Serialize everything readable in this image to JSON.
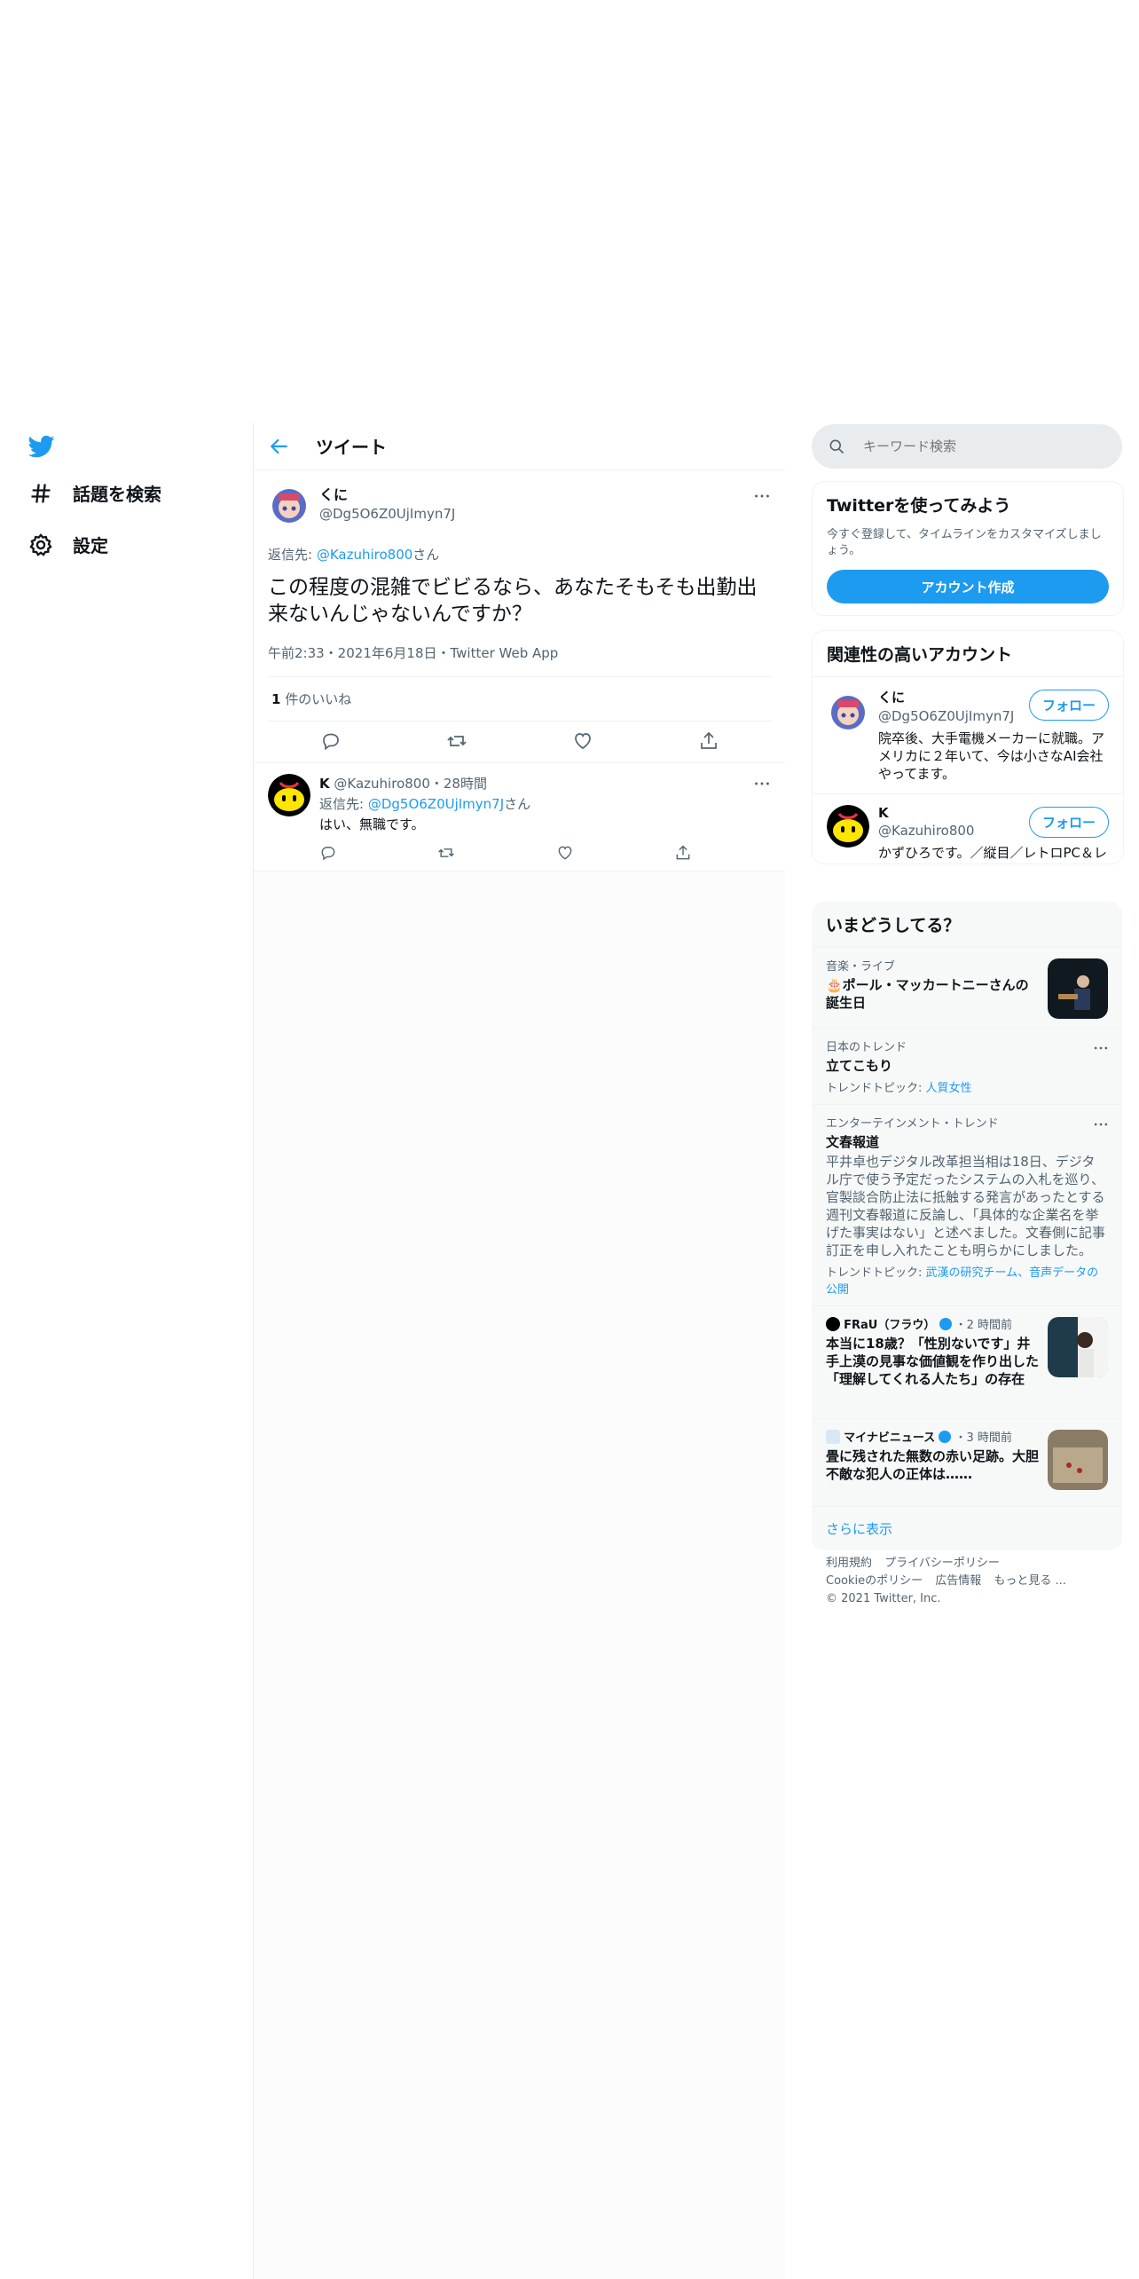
{
  "nav": {
    "explore_label": "話題を検索",
    "settings_label": "設定"
  },
  "main": {
    "header_title": "ツイート",
    "tweet": {
      "name": "くに",
      "handle": "@Dg5O6Z0UjImyn7J",
      "reply_prefix": "返信先: ",
      "reply_to": "@Kazuhiro800",
      "reply_suffix": "さん",
      "text": "この程度の混雑でビビるなら、あなたそもそも出勤出来ないんじゃないんですか？",
      "meta": "午前2:33・2021年6月18日・Twitter Web App",
      "likes_count": "1",
      "likes_label": " 件のいいね"
    },
    "reply": {
      "name": "K",
      "handle": "@Kazuhiro800",
      "time": "・28時間",
      "reply_prefix": "返信先: ",
      "reply_to": "@Dg5O6Z0UjImyn7J",
      "reply_suffix": "さん",
      "text": "はい、無職です。"
    }
  },
  "right": {
    "search_placeholder": "キーワード検索",
    "signup": {
      "title": "Twitterを使ってみよう",
      "desc": "今すぐ登録して、タイムラインをカスタマイズしましょう。",
      "button": "アカウント作成"
    },
    "relevant": {
      "title": "関連性の高いアカウント",
      "follow_label": "フォロー",
      "accounts": [
        {
          "name": "くに",
          "handle": "@Dg5O6Z0UjImyn7J",
          "bio": "院卒後、大手電機メーカーに就職。アメリカに２年いて、今は小さなAI会社やってます。"
        },
        {
          "name": "K",
          "handle": "@Kazuhiro800",
          "bio": "かずひろです。／縦目／レトロPC＆レトロゲーム／VR／中国／初音ミク"
        }
      ]
    },
    "trends": {
      "title": "いまどうしてる？",
      "items": [
        {
          "cat": "音楽・ライブ",
          "title": "🎂ポール・マッカートニーさんの誕生日"
        },
        {
          "cat": "日本のトレンド",
          "title": "立てこもり",
          "topic_prefix": "トレンドトピック: ",
          "topic": "人質女性"
        },
        {
          "cat": "エンターテインメント・トレンド",
          "title": "文春報道",
          "desc": "平井卓也デジタル改革担当相は18日、デジタル庁で使う予定だったシステムの入札を巡り、官製談合防止法に抵触する発言があったとする週刊文春報道に反論し、「具体的な企業名を挙げた事実はない」と述べました。文春側に記事訂正を申し入れたことも明らかにしました。",
          "topic_prefix": "トレンドトピック: ",
          "topic": "武漢の研究チーム、音声データの公開"
        },
        {
          "source": "FRaU（フラウ）",
          "time": "・2 時間前",
          "title": "本当に18歳？「性別ないです」井手上漠の見事な価値観を作り出した「理解してくれる人たち」の存在"
        },
        {
          "source": "マイナビニュース",
          "time": "・3 時間前",
          "title": "畳に残された無数の赤い足跡。大胆不敵な犯人の正体は……"
        }
      ],
      "show_more": "さらに表示"
    },
    "footer": {
      "links1": [
        "利用規約",
        "プライバシーポリシー"
      ],
      "links2": [
        "Cookieのポリシー",
        "広告情報",
        "もっと見る ..."
      ],
      "copyright": "© 2021 Twitter, Inc."
    }
  }
}
